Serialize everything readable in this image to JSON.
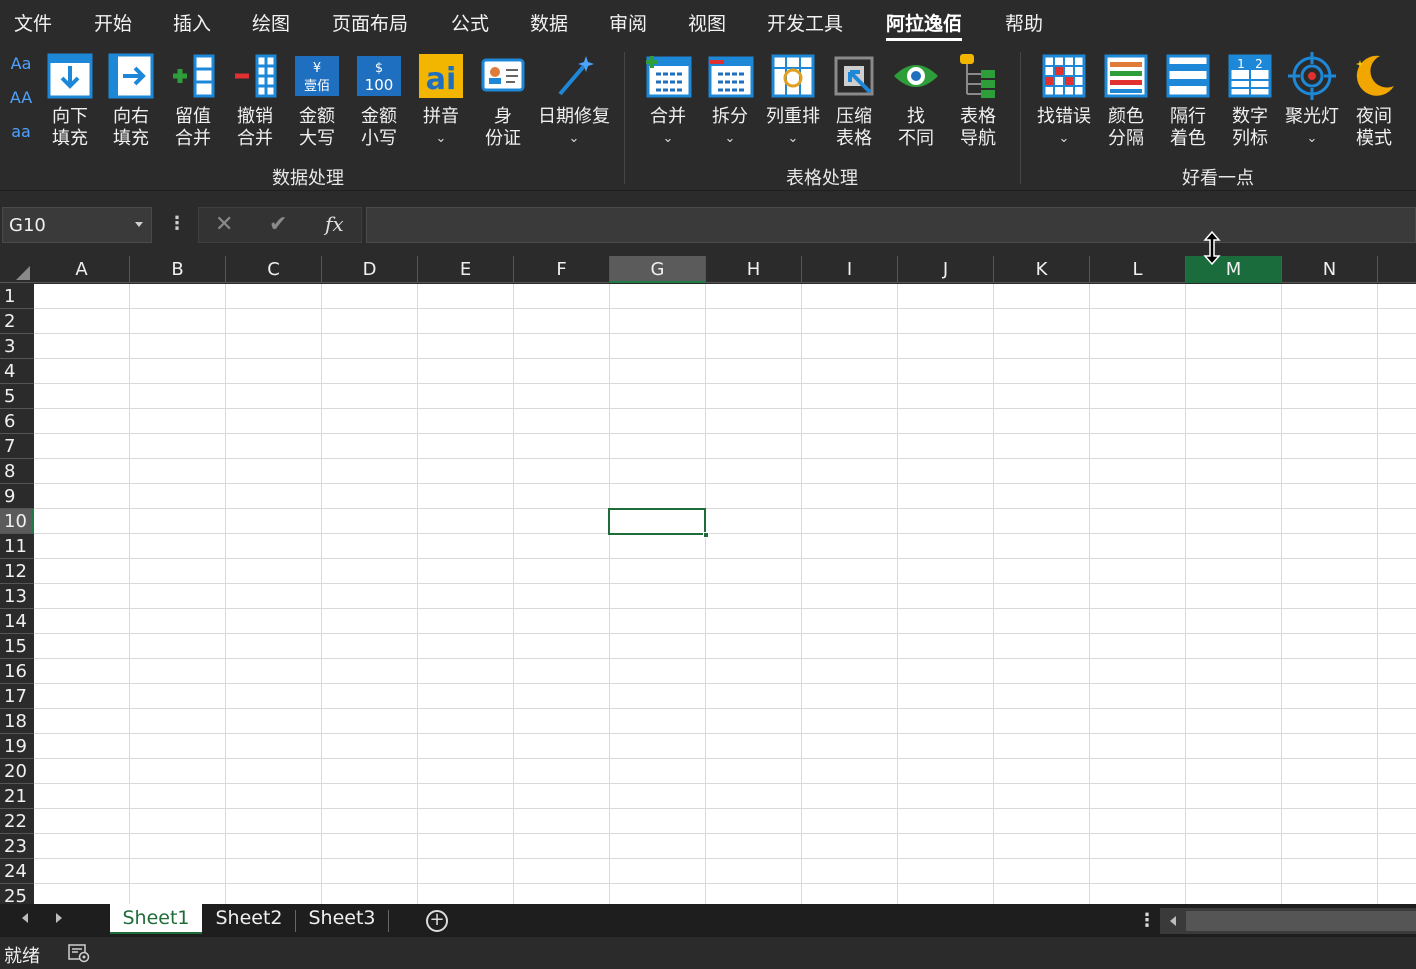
{
  "menu": [
    "文件",
    "开始",
    "插入",
    "绘图",
    "页面布局",
    "公式",
    "数据",
    "审阅",
    "视图",
    "开发工具",
    "阿拉逸佰",
    "帮助"
  ],
  "menu_active": "阿拉逸佰",
  "ribbon": {
    "case_buttons": [
      "Aa",
      "AA",
      "aa"
    ],
    "groups": [
      {
        "label": "数据处理",
        "buttons": [
          {
            "l1": "向下",
            "l2": "填充"
          },
          {
            "l1": "向右",
            "l2": "填充"
          },
          {
            "l1": "留值",
            "l2": "合并"
          },
          {
            "l1": "撤销",
            "l2": "合并"
          },
          {
            "l1": "金额",
            "l2": "大写",
            "icon_text": "¥ 壹佰"
          },
          {
            "l1": "金额",
            "l2": "小写",
            "icon_text": "$ 100"
          },
          {
            "l1": "拼音",
            "l2": "⌄",
            "icon_text": "ai"
          },
          {
            "l1": "身",
            "l2": "份证"
          },
          {
            "l1": "日期修复",
            "l2": "⌄"
          }
        ]
      },
      {
        "label": "表格处理",
        "buttons": [
          {
            "l1": "合并",
            "l2": "⌄"
          },
          {
            "l1": "拆分",
            "l2": "⌄"
          },
          {
            "l1": "列重排",
            "l2": "⌄"
          },
          {
            "l1": "压缩",
            "l2": "表格"
          },
          {
            "l1": "找",
            "l2": "不同"
          },
          {
            "l1": "表格",
            "l2": "导航"
          }
        ]
      },
      {
        "label": "好看一点",
        "buttons": [
          {
            "l1": "找错误",
            "l2": "⌄"
          },
          {
            "l1": "颜色",
            "l2": "分隔"
          },
          {
            "l1": "隔行",
            "l2": "着色"
          },
          {
            "l1": "数字",
            "l2": "列标",
            "icon_text": "1 2"
          },
          {
            "l1": "聚光灯",
            "l2": "⌄"
          },
          {
            "l1": "夜间",
            "l2": "模式"
          }
        ]
      }
    ]
  },
  "formula_bar": {
    "name_box": "G10",
    "fx": "fx",
    "cancel": "✕",
    "enter": "✔",
    "value": ""
  },
  "columns": [
    "A",
    "B",
    "C",
    "D",
    "E",
    "F",
    "G",
    "H",
    "I",
    "J",
    "K",
    "L",
    "M",
    "N"
  ],
  "selected_column": "G",
  "hover_column": "M",
  "rows": [
    "1",
    "2",
    "3",
    "4",
    "5",
    "6",
    "7",
    "8",
    "9",
    "10",
    "11",
    "12",
    "13",
    "14",
    "15",
    "16",
    "17",
    "18",
    "19",
    "20",
    "21",
    "22",
    "23",
    "24",
    "25"
  ],
  "selected_row": "10",
  "active_cell": "G10",
  "sheets": [
    "Sheet1",
    "Sheet2",
    "Sheet3"
  ],
  "active_sheet": "Sheet1",
  "status": {
    "text": "就绪"
  },
  "colors": {
    "accent_green": "#1f6b3a",
    "header_green": "#1a6c3c",
    "ribbon_bg": "#2b2b2b",
    "icon_blue": "#1e88d8"
  }
}
